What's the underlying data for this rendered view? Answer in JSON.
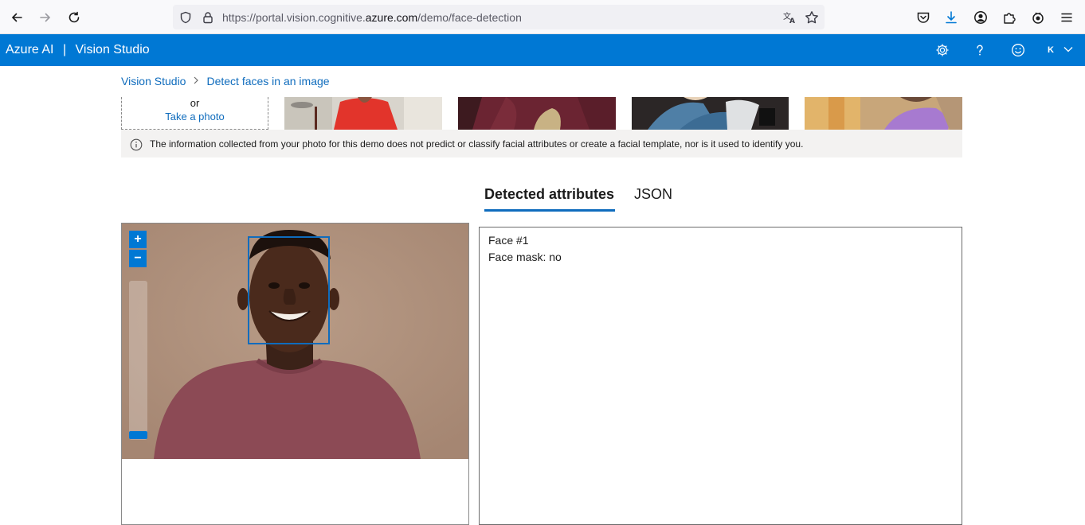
{
  "browser": {
    "url_prefix": "https://portal.vision.cognitive.",
    "url_domain": "azure.com",
    "url_path": "/demo/face-detection"
  },
  "app": {
    "brand": "Azure AI",
    "separator": "|",
    "product": "Vision Studio",
    "user_initial": "K"
  },
  "breadcrumb": {
    "items": [
      "Vision Studio",
      "Detect faces in an image"
    ]
  },
  "upload": {
    "or_text": "or",
    "take_photo": "Take a photo"
  },
  "notice": {
    "text": "The information collected from your photo for this demo does not predict or classify facial attributes or create a facial template, nor is it used to identify you."
  },
  "tabs": [
    {
      "label": "Detected attributes",
      "active": true
    },
    {
      "label": "JSON",
      "active": false
    }
  ],
  "viewer": {
    "zoom_in": "+",
    "zoom_out": "−",
    "zoom_level": 0
  },
  "results": {
    "lines": [
      "Face #1",
      "Face mask: no"
    ]
  },
  "colors": {
    "accent": "#0078d4",
    "link": "#0f6cbd",
    "notice_bg": "#f3f2f1"
  },
  "icons": [
    "back-arrow-icon",
    "forward-arrow-icon",
    "reload-icon",
    "shield-icon",
    "lock-icon",
    "translate-icon",
    "bookmark-star-icon",
    "pocket-icon",
    "download-icon",
    "account-icon",
    "extensions-icon",
    "addon-icon",
    "menu-icon",
    "gear-icon",
    "help-icon",
    "feedback-smiley-icon",
    "chevron-down-icon",
    "info-icon"
  ]
}
